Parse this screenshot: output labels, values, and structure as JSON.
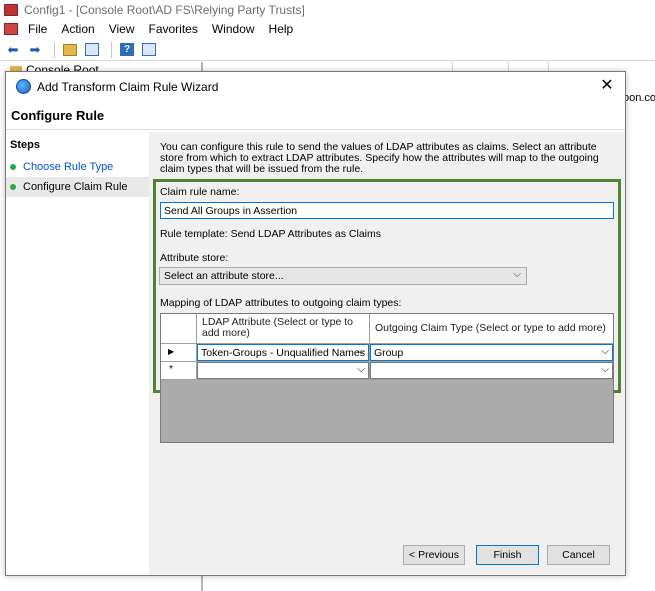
{
  "mmc": {
    "title": "Config1 - [Console Root\\AD FS\\Relying Party Trusts]",
    "menu": [
      "File",
      "Action",
      "View",
      "Favorites",
      "Window",
      "Help"
    ],
    "tree_label": "Console Root",
    "bg_text": "oon.com"
  },
  "dialog": {
    "title": "Add Transform Claim Rule Wizard",
    "close": "✕",
    "header": "Configure Rule",
    "steps_title": "Steps",
    "steps": [
      {
        "label": "Choose Rule Type"
      },
      {
        "label": "Configure Claim Rule"
      }
    ],
    "intro": "You can configure this rule to send the values of LDAP attributes as claims. Select an attribute store from which to extract LDAP attributes. Specify how the attributes will map to the outgoing claim types that will be issued from the rule.",
    "claim_rule_name_label": "Claim rule name:",
    "claim_rule_name_value": "Send All Groups in Assertion",
    "rule_template": "Rule template: Send LDAP Attributes as Claims",
    "attribute_store_label": "Attribute store:",
    "attribute_store_placeholder": "Select an attribute store...",
    "mapping_label": "Mapping of LDAP attributes to outgoing claim types:",
    "grid": {
      "headers": [
        "LDAP Attribute (Select or type to add more)",
        "Outgoing Claim Type (Select or type to add more)"
      ],
      "rows": [
        {
          "marker": "▶",
          "ldap": "Token-Groups - Unqualified Names",
          "claim": "Group"
        },
        {
          "marker": "*",
          "ldap": "",
          "claim": ""
        }
      ]
    },
    "buttons": {
      "previous": "< Previous",
      "finish": "Finish",
      "cancel": "Cancel"
    }
  }
}
